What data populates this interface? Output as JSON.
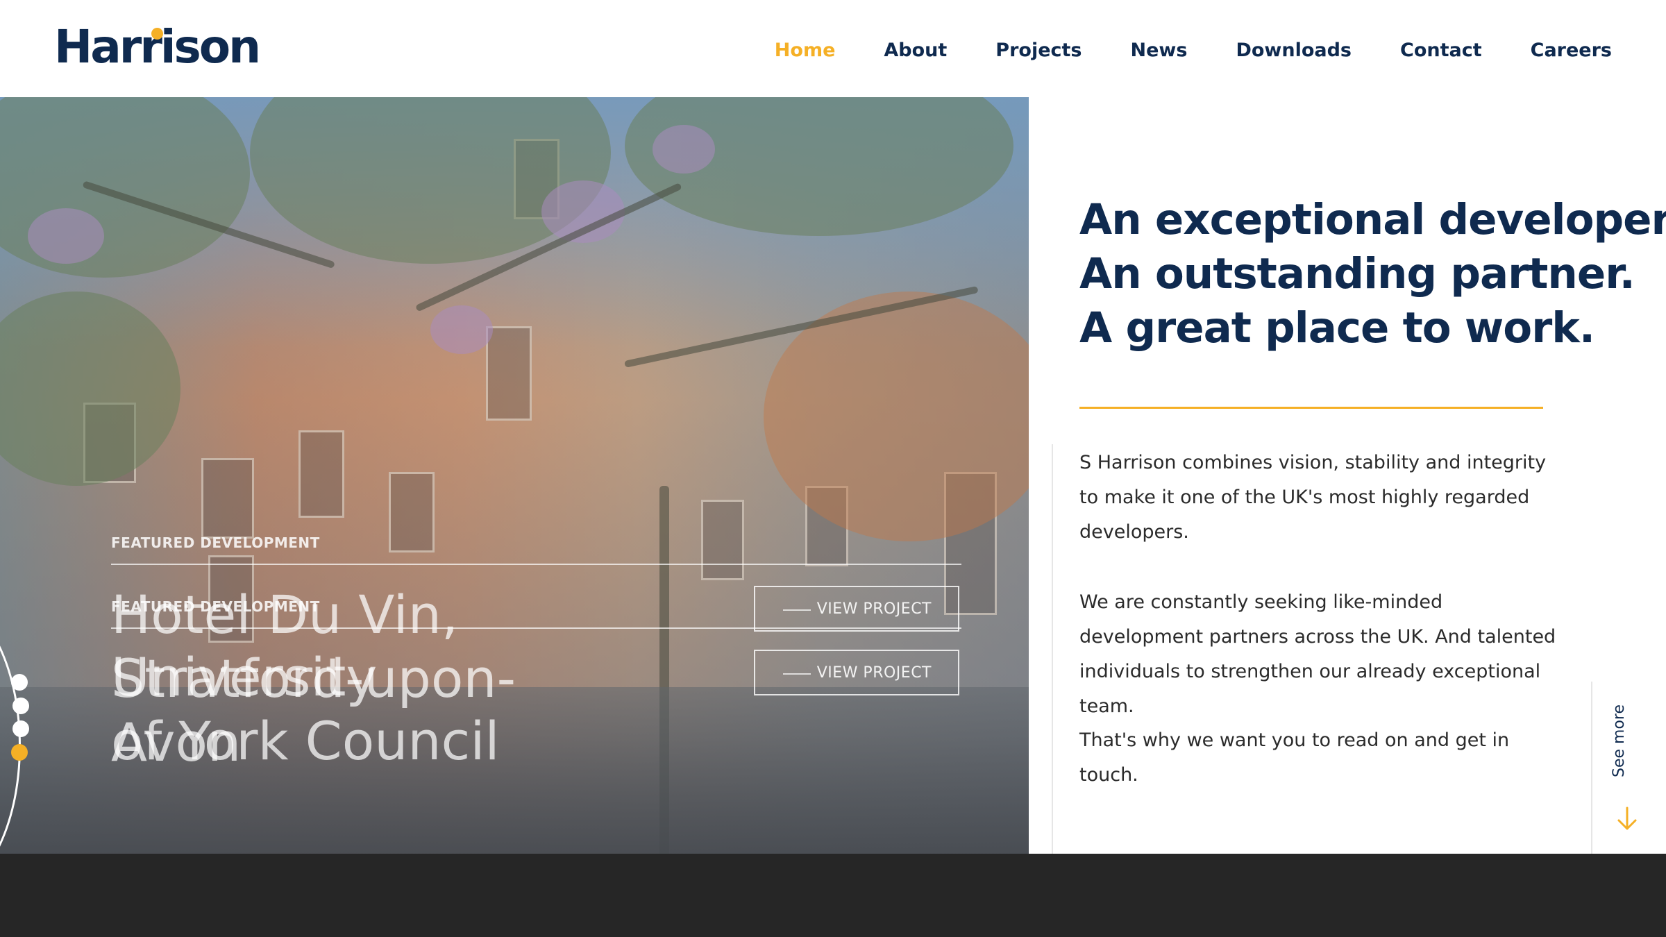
{
  "brand": {
    "name": "Harrison",
    "accent": "#f5b026",
    "navy": "#0f2a4f"
  },
  "nav": [
    {
      "label": "Home",
      "active": true
    },
    {
      "label": "About"
    },
    {
      "label": "Projects"
    },
    {
      "label": "News"
    },
    {
      "label": "Downloads"
    },
    {
      "label": "Contact"
    },
    {
      "label": "Careers"
    }
  ],
  "hero": {
    "slides": [
      {
        "label": "FEATURED DEVELOPMENT",
        "title_line1": "Hotel Du Vin,",
        "title_line2": "Stratford-upon-",
        "title_line3": "Avon",
        "button": "VIEW PROJECT"
      },
      {
        "label": "FEATURED DEVELOPMENT",
        "title_line1": "University",
        "title_line2": "of York Council",
        "button": "VIEW PROJECT"
      }
    ],
    "pagination_count": 4,
    "pagination_active": 4
  },
  "headline": {
    "line1": "An exceptional developer.",
    "line2": "An outstanding partner.",
    "line3": "A great place to work."
  },
  "body": {
    "p1": "S Harrison combines vision, stability and integrity to make it one of the UK's most highly regarded developers.",
    "p2": "We are constantly seeking like-minded development partners across the UK. And talented individuals to strengthen our already exceptional team.",
    "p3": "That's why we want you to read on and get in touch."
  },
  "see_more": "See more",
  "icons": {
    "scroll": "arrow-down-icon"
  }
}
